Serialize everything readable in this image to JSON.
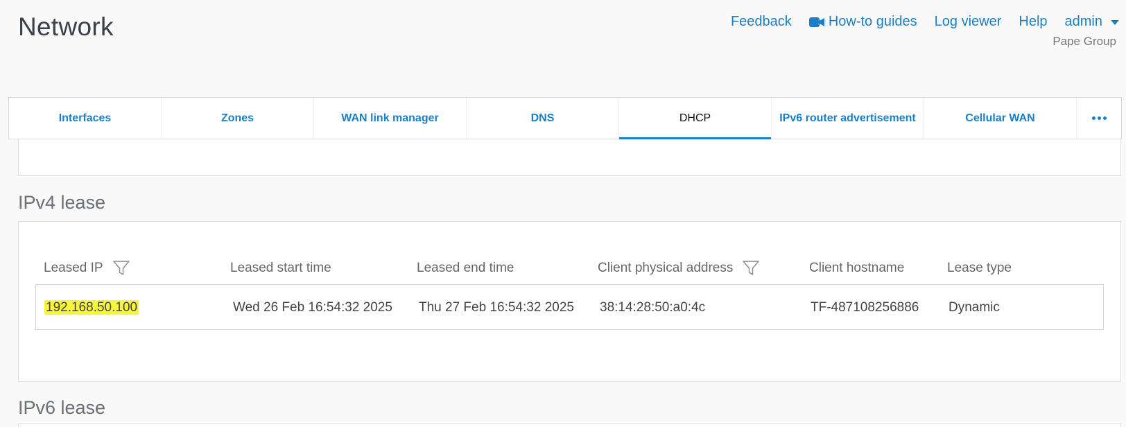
{
  "header": {
    "title": "Network",
    "org": "Pape Group",
    "nav": {
      "feedback": "Feedback",
      "howto": "How-to guides",
      "logviewer": "Log viewer",
      "help": "Help",
      "user": "admin"
    }
  },
  "tabs": [
    {
      "label": "Interfaces"
    },
    {
      "label": "Zones"
    },
    {
      "label": "WAN link manager"
    },
    {
      "label": "DNS"
    },
    {
      "label": "DHCP",
      "active": true
    },
    {
      "label": "IPv6 router advertisement"
    },
    {
      "label": "Cellular WAN"
    }
  ],
  "ipv4": {
    "title": "IPv4 lease",
    "columns": {
      "leased_ip": "Leased IP",
      "start": "Leased start time",
      "end": "Leased end time",
      "mac": "Client physical address",
      "hostname": "Client hostname",
      "type": "Lease type"
    },
    "rows": [
      {
        "leased_ip": "192.168.50.100",
        "start": "Wed 26 Feb 16:54:32 2025",
        "end": "Thu 27 Feb 16:54:32 2025",
        "mac": "38:14:28:50:a0:4c",
        "hostname": "TF-487108256886",
        "type": "Dynamic"
      }
    ]
  },
  "ipv6": {
    "title": "IPv6 lease"
  },
  "colors": {
    "accent": "#1a7fc6",
    "highlight": "#f7f73a"
  }
}
